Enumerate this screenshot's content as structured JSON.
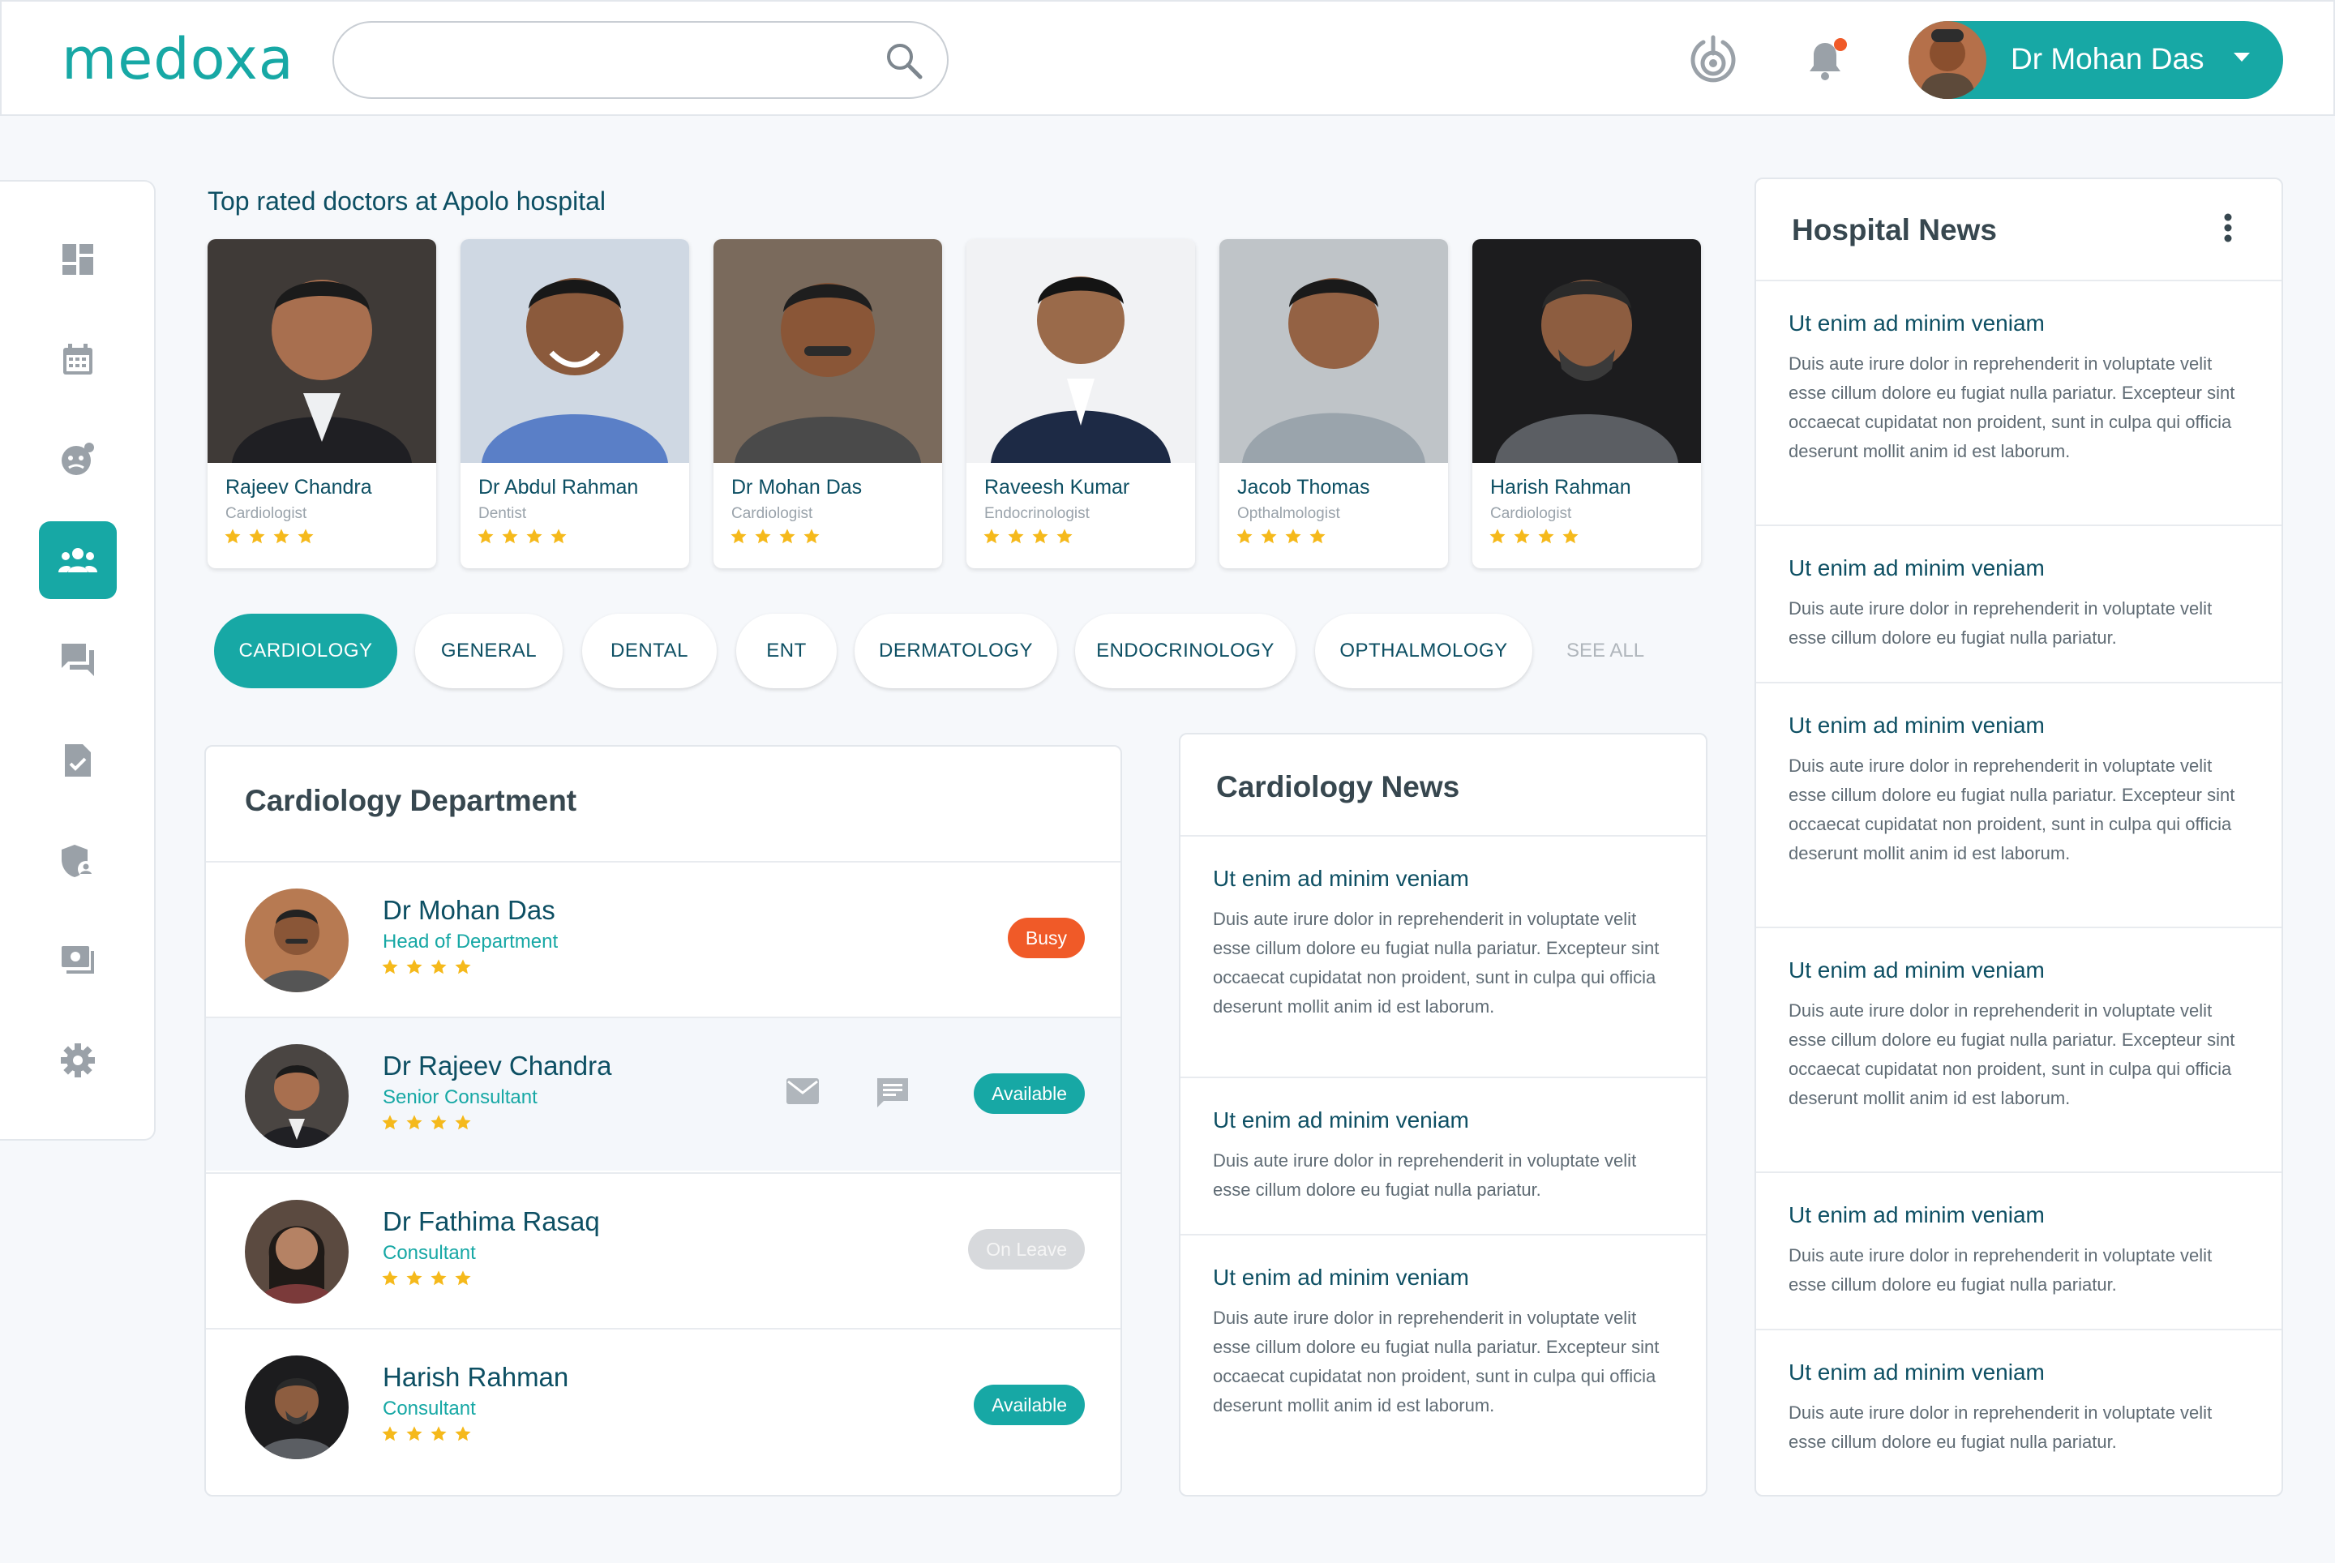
{
  "app": {
    "logo": "medoxa"
  },
  "header": {
    "search_placeholder": "",
    "user_name": "Dr Mohan Das"
  },
  "sidebar": {
    "items": [
      {
        "icon": "dashboard-icon"
      },
      {
        "icon": "calendar-icon"
      },
      {
        "icon": "patient-icon"
      },
      {
        "icon": "doctors-group-icon",
        "active": true
      },
      {
        "icon": "chat-icon"
      },
      {
        "icon": "report-check-icon"
      },
      {
        "icon": "shield-user-icon"
      },
      {
        "icon": "payments-icon"
      },
      {
        "icon": "settings-icon"
      }
    ]
  },
  "top_rated": {
    "title": "Top rated doctors at Apolo hospital",
    "doctors": [
      {
        "name": "Rajeev Chandra",
        "specialty": "Cardiologist",
        "rating": 4
      },
      {
        "name": "Dr Abdul Rahman",
        "specialty": "Dentist",
        "rating": 4
      },
      {
        "name": "Dr Mohan Das",
        "specialty": "Cardiologist",
        "rating": 4
      },
      {
        "name": "Raveesh Kumar",
        "specialty": "Endocrinologist",
        "rating": 4
      },
      {
        "name": "Jacob Thomas",
        "specialty": "Opthalmologist",
        "rating": 4
      },
      {
        "name": "Harish Rahman",
        "specialty": "Cardiologist",
        "rating": 4
      }
    ]
  },
  "categories": {
    "items": [
      "CARDIOLOGY",
      "GENERAL",
      "DENTAL",
      "ENT",
      "DERMATOLOGY",
      "ENDOCRINOLOGY",
      "OPTHALMOLOGY"
    ],
    "active": "CARDIOLOGY",
    "see_all": "SEE ALL"
  },
  "department": {
    "title": "Cardiology Department",
    "members": [
      {
        "name": "Dr Mohan Das",
        "role": "Head of Department",
        "rating": 4,
        "status": "Busy"
      },
      {
        "name": "Dr Rajeev Chandra",
        "role": "Senior Consultant",
        "rating": 4,
        "status": "Available"
      },
      {
        "name": "Dr Fathima Rasaq",
        "role": "Consultant",
        "rating": 4,
        "status": "On Leave"
      },
      {
        "name": "Harish Rahman",
        "role": "Consultant",
        "rating": 4,
        "status": "Available"
      }
    ]
  },
  "cardiology_news": {
    "title": "Cardiology News",
    "items": [
      {
        "title": "Ut enim ad minim veniam",
        "body": "Duis aute irure dolor in reprehenderit in voluptate velit esse cillum dolore eu fugiat nulla pariatur. Excepteur sint occaecat cupidatat non proident, sunt in culpa qui officia deserunt mollit anim id est laborum."
      },
      {
        "title": "Ut enim ad minim veniam",
        "body": "Duis aute irure dolor in reprehenderit in voluptate velit esse cillum dolore eu fugiat nulla pariatur."
      },
      {
        "title": "Ut enim ad minim veniam",
        "body": "Duis aute irure dolor in reprehenderit in voluptate velit esse cillum dolore eu fugiat nulla pariatur. Excepteur sint occaecat cupidatat non proident, sunt in culpa qui officia deserunt mollit anim id est laborum."
      }
    ]
  },
  "hospital_news": {
    "title": "Hospital News",
    "items": [
      {
        "title": "Ut enim ad minim veniam",
        "body": "Duis aute irure dolor in reprehenderit in voluptate velit esse cillum dolore eu fugiat nulla pariatur. Excepteur sint occaecat cupidatat non proident, sunt in culpa qui officia deserunt mollit anim id est laborum."
      },
      {
        "title": "Ut enim ad minim veniam",
        "body": "Duis aute irure dolor in reprehenderit in voluptate velit esse cillum dolore eu fugiat nulla pariatur."
      },
      {
        "title": "Ut enim ad minim veniam",
        "body": "Duis aute irure dolor in reprehenderit in voluptate velit esse cillum dolore eu fugiat nulla pariatur. Excepteur sint occaecat cupidatat non proident, sunt in culpa qui officia deserunt mollit anim id est laborum."
      },
      {
        "title": "Ut enim ad minim veniam",
        "body": "Duis aute irure dolor in reprehenderit in voluptate velit esse cillum dolore eu fugiat nulla pariatur. Excepteur sint occaecat cupidatat non proident, sunt in culpa qui officia deserunt mollit anim id est laborum."
      },
      {
        "title": "Ut enim ad minim veniam",
        "body": "Duis aute irure dolor in reprehenderit in voluptate velit esse cillum dolore eu fugiat nulla pariatur."
      },
      {
        "title": "Ut enim ad minim veniam",
        "body": "Duis aute irure dolor in reprehenderit in voluptate velit esse cillum dolore eu fugiat nulla pariatur."
      }
    ]
  },
  "colors": {
    "accent": "#17a8a5",
    "busy": "#f05a28",
    "leave": "#d7d9dc",
    "star": "#f5b91b",
    "heading": "#0d4f63"
  }
}
